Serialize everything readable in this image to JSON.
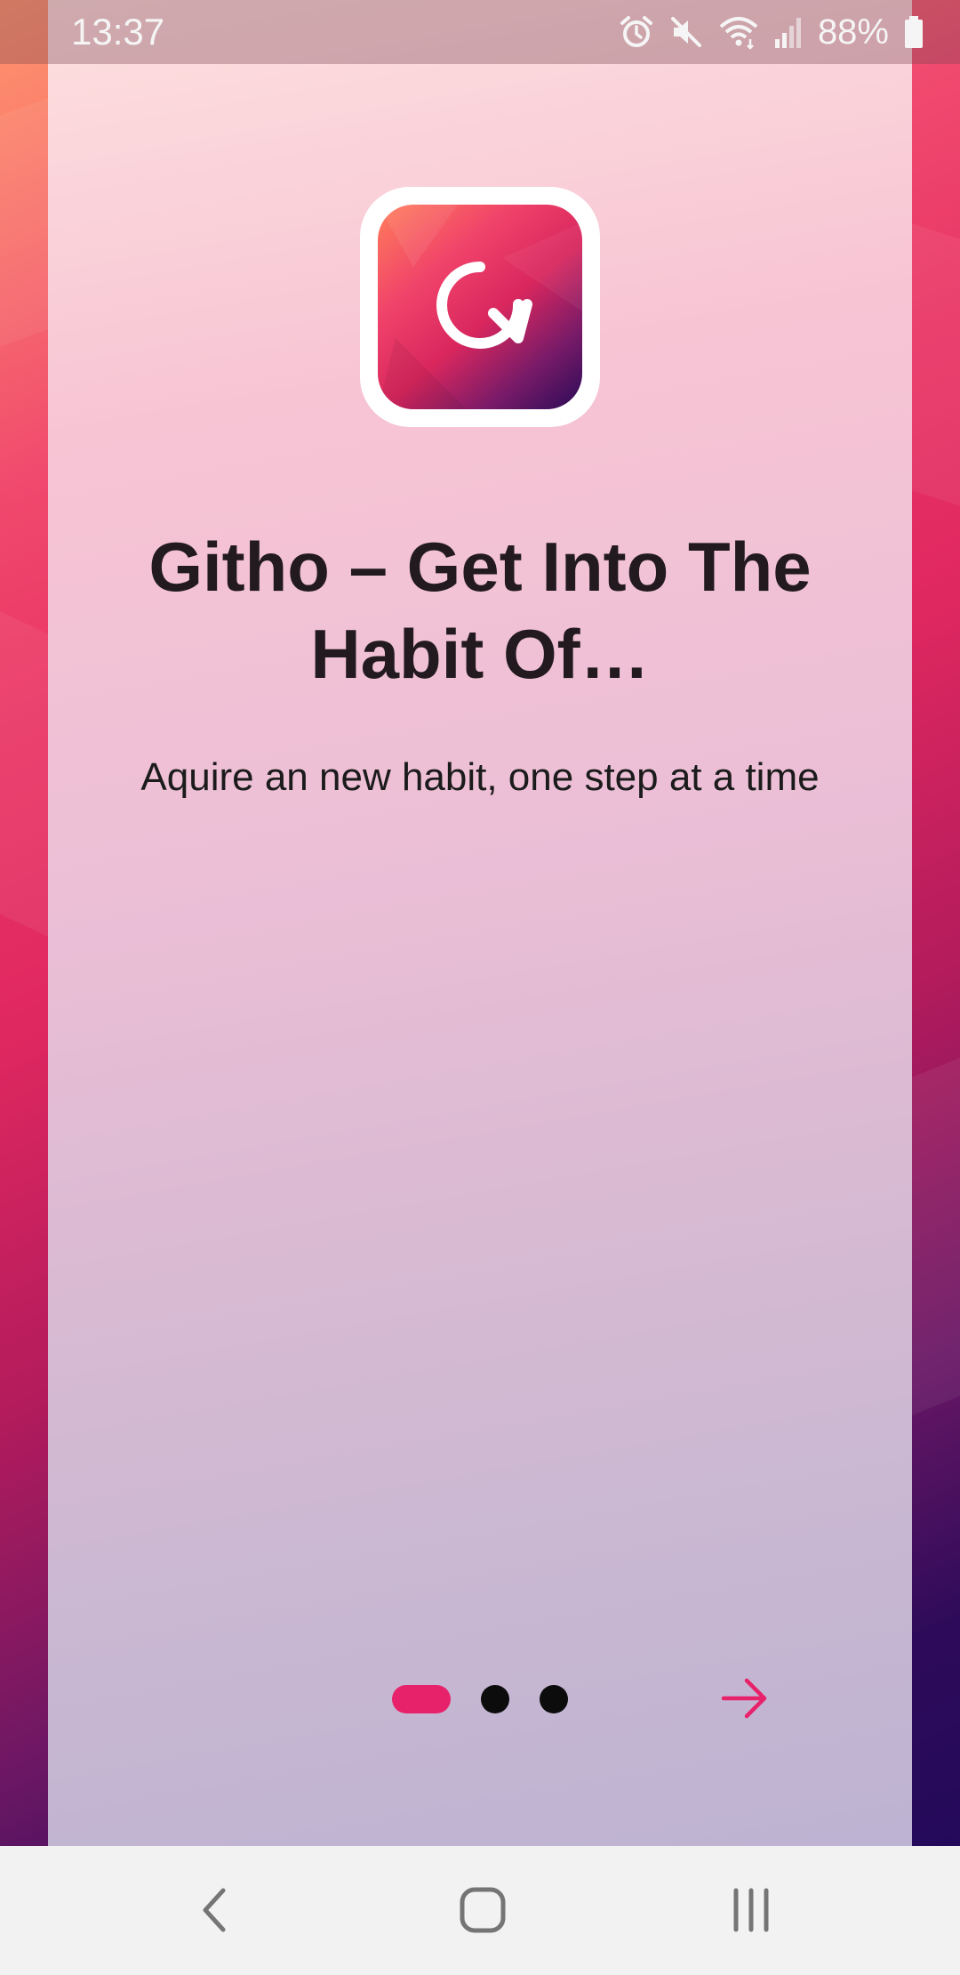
{
  "status_bar": {
    "time": "13:37",
    "battery": "88%",
    "icons": [
      "alarm-icon",
      "mute-icon",
      "wifi-icon",
      "signal-icon",
      "battery-icon"
    ]
  },
  "onboarding": {
    "app_icon": "githo-refresh-logo",
    "title": "Githo – Get Into The Habit Of…",
    "subtitle": "Aquire an new habit, one step at a time",
    "pages": {
      "current": 1,
      "total": 3
    },
    "next_icon": "arrow-right-icon"
  },
  "colors": {
    "accent": "#e8226a",
    "title": "#221a1e",
    "dot_inactive": "#0c0c0c",
    "gradient_start": "#ff8a5c",
    "gradient_end": "#24095a"
  },
  "nav_bar": {
    "icons": [
      "back-icon",
      "home-icon",
      "recents-icon"
    ]
  }
}
